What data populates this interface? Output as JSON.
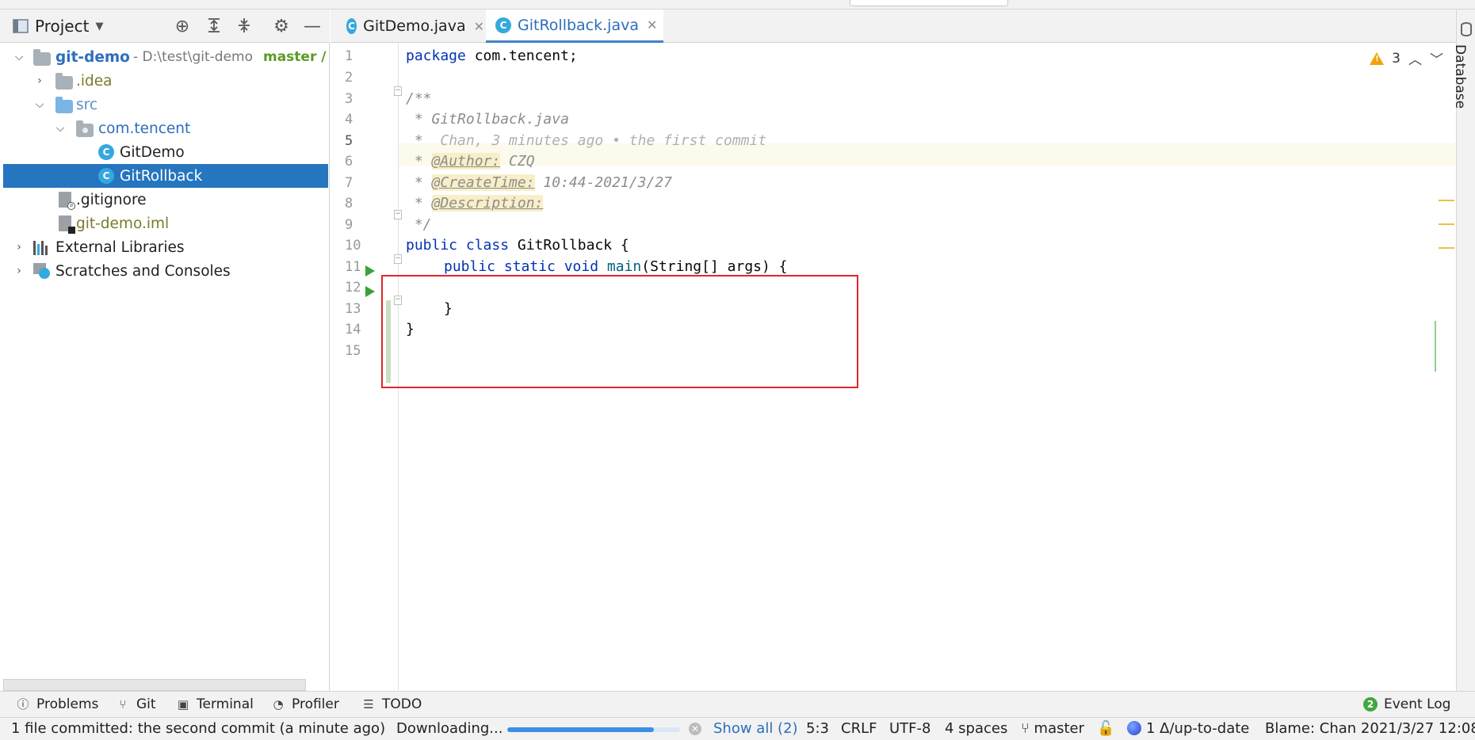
{
  "project_panel": {
    "title": "Project",
    "tree": [
      {
        "label": "git-demo",
        "path": "- D:\\test\\git-demo",
        "branch": "master / '"
      },
      {
        "label": ".idea"
      },
      {
        "label": "src"
      },
      {
        "label": "com.tencent"
      },
      {
        "label": "GitDemo"
      },
      {
        "label": "GitRollback"
      },
      {
        "label": ".gitignore"
      },
      {
        "label": "git-demo.iml"
      },
      {
        "label": "External Libraries"
      },
      {
        "label": "Scratches and Consoles"
      }
    ]
  },
  "tabs": [
    {
      "label": "GitDemo.java",
      "active": false
    },
    {
      "label": "GitRollback.java",
      "active": true
    }
  ],
  "editor": {
    "warning_count": "3",
    "line_numbers": [
      "1",
      "2",
      "3",
      "4",
      "5",
      "6",
      "7",
      "8",
      "9",
      "10",
      "11",
      "12",
      "13",
      "14",
      "15"
    ],
    "code": {
      "l1_kw": "package",
      "l1_rest": " com.tencent;",
      "l3": "/**",
      "l4": " * GitRollback.java",
      "l5_star": " *  ",
      "l5_blame": "Chan, 3 minutes ago • the first commit",
      "l6_star": " * ",
      "l6_tag": "@Author:",
      "l6_val": " CZQ",
      "l7_star": " * ",
      "l7_tag": "@CreateTime:",
      "l7_val": " 10:44-2021/3/27",
      "l8_star": " * ",
      "l8_tag": "@Description:",
      "l9": " */",
      "l10_kw": "public class",
      "l10_rest": " GitRollback {",
      "l11_kw": "public static void",
      "l11_fn": "main",
      "l11_rest": "(String[] args) {",
      "l13": "}",
      "l14": "}"
    }
  },
  "right_stripe": {
    "label": "Database"
  },
  "tool_windows": [
    {
      "label": "Problems",
      "icon": "info-icon"
    },
    {
      "label": "Git",
      "icon": "branch-icon"
    },
    {
      "label": "Terminal",
      "icon": "terminal-icon"
    },
    {
      "label": "Profiler",
      "icon": "profiler-icon"
    },
    {
      "label": "TODO",
      "icon": "list-icon"
    }
  ],
  "event_log": {
    "label": "Event Log",
    "count": "2"
  },
  "status": {
    "message": "1 file committed: the second commit (a minute ago)",
    "downloading": "Downloading...",
    "progress": 0.85,
    "show_all": "Show all (2)",
    "caret": "5:3",
    "line_sep": "CRLF",
    "encoding": "UTF-8",
    "indent": "4 spaces",
    "branch": "master",
    "vcs": "1 Δ/up-to-date",
    "blame": "Blame: Chan 2021/3/27 12:08"
  },
  "colors": {
    "accent": "#2675bf",
    "highlight_box": "#e3262d",
    "run_icon": "#3aa23a",
    "warning": "#f0a30a"
  }
}
